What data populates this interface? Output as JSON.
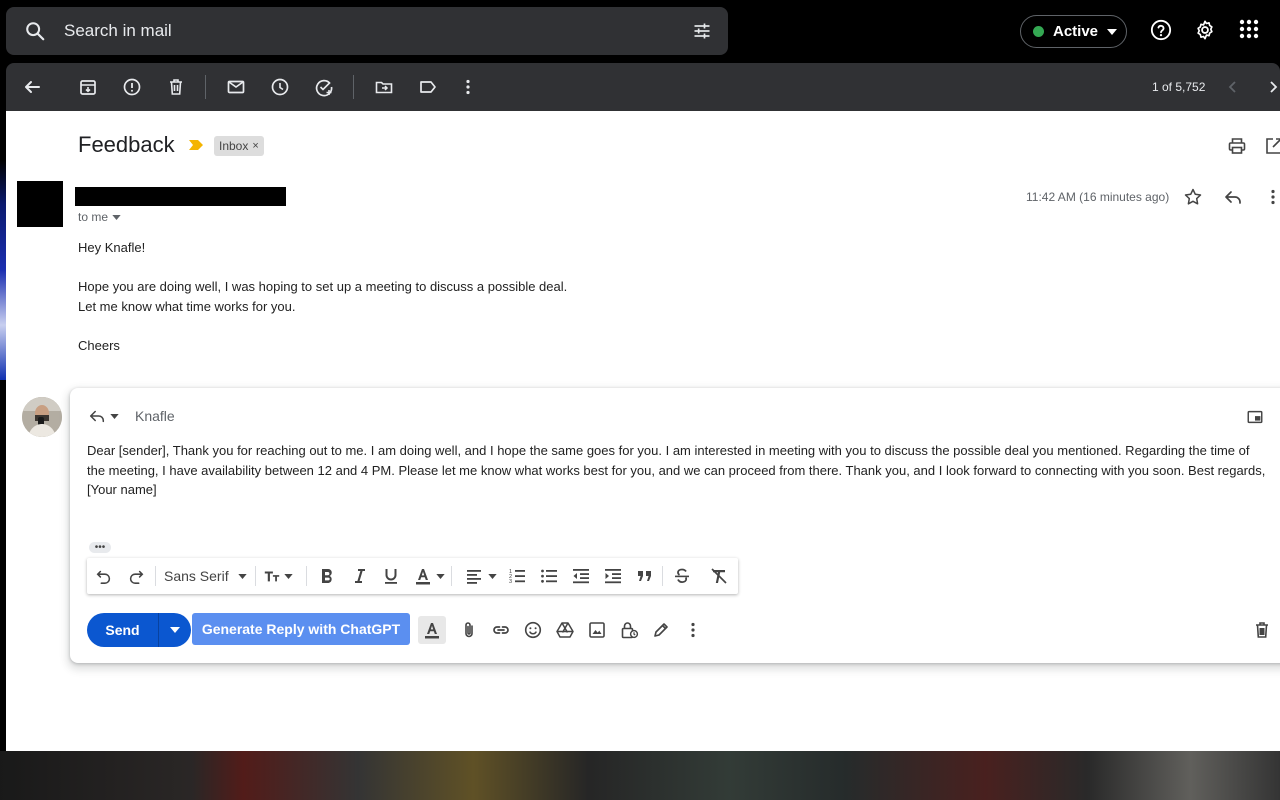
{
  "search": {
    "placeholder": "Search in mail"
  },
  "header": {
    "status_label": "Active"
  },
  "toolbar": {
    "pager": "1 of 5,752"
  },
  "email": {
    "subject": "Feedback",
    "label": "Inbox",
    "label_remove": "×",
    "to": "to me",
    "time": "11:42 AM (16 minutes ago)",
    "body": {
      "greeting": "Hey Knafle!",
      "line1": "Hope you are doing well, I was hoping to set up a meeting to discuss a possible deal.",
      "line2": "Let me know what time works for you.",
      "signoff": "Cheers"
    }
  },
  "reply": {
    "recipient": "Knafle",
    "text": "Dear [sender], Thank you for reaching out to me. I am doing well, and I hope the same goes for you. I am interested in meeting with you to discuss the possible deal you mentioned. Regarding the time of the meeting, I have availability between 12 and 4 PM. Please let me know what works best for you, and we can proceed from there. Thank you, and I look forward to connecting with you soon. Best regards, [Your name]",
    "more_dots": "•••",
    "font": "Sans Serif",
    "send_label": "Send",
    "gpt_label": "Generate Reply with ChatGPT"
  },
  "colors": {
    "primary_button": "#0b57d0",
    "gpt_button": "#5b8ff0",
    "status_dot": "#34a853",
    "importance": "#f4b400"
  },
  "icons": [
    "search-icon",
    "tune-icon",
    "help-icon",
    "settings-icon",
    "apps-icon",
    "back-arrow-icon",
    "archive-icon",
    "report-spam-icon",
    "delete-icon",
    "mark-unread-icon",
    "snooze-icon",
    "add-task-icon",
    "move-to-icon",
    "label-icon",
    "more-vert-icon",
    "chevron-left-icon",
    "chevron-right-icon",
    "print-icon",
    "open-new-window-icon",
    "star-icon",
    "reply-icon",
    "pop-out-icon",
    "undo-icon",
    "redo-icon",
    "text-size-icon",
    "bold-icon",
    "italic-icon",
    "underline-icon",
    "text-color-icon",
    "align-icon",
    "numbered-list-icon",
    "bulleted-list-icon",
    "indent-less-icon",
    "indent-more-icon",
    "quote-icon",
    "strikethrough-icon",
    "remove-formatting-icon",
    "attach-icon",
    "link-icon",
    "emoji-icon",
    "drive-icon",
    "photo-icon",
    "confidential-icon",
    "signature-icon",
    "discard-icon"
  ]
}
